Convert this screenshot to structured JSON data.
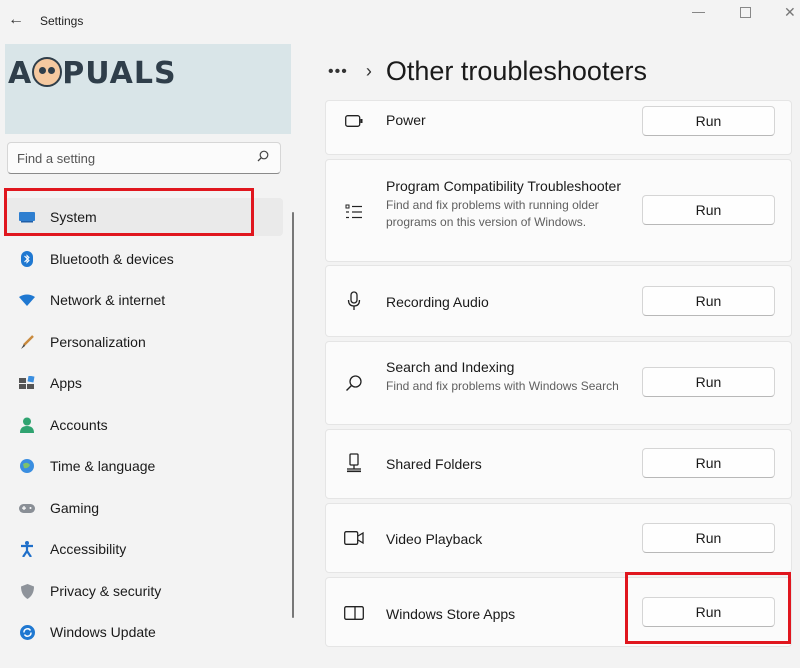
{
  "window": {
    "title": "Settings",
    "back_glyph": "←",
    "minimize_glyph": "—",
    "close_glyph": "✕"
  },
  "logo": {
    "left": "A",
    "right": "PUALS"
  },
  "search": {
    "placeholder": "Find a setting"
  },
  "sidebar": {
    "items": [
      {
        "label": "System",
        "icon": "system-icon"
      },
      {
        "label": "Bluetooth & devices",
        "icon": "bluetooth-icon"
      },
      {
        "label": "Network & internet",
        "icon": "wifi-icon"
      },
      {
        "label": "Personalization",
        "icon": "brush-icon"
      },
      {
        "label": "Apps",
        "icon": "apps-icon"
      },
      {
        "label": "Accounts",
        "icon": "person-icon"
      },
      {
        "label": "Time & language",
        "icon": "globe-clock-icon"
      },
      {
        "label": "Gaming",
        "icon": "gamepad-icon"
      },
      {
        "label": "Accessibility",
        "icon": "accessibility-icon"
      },
      {
        "label": "Privacy & security",
        "icon": "shield-icon"
      },
      {
        "label": "Windows Update",
        "icon": "update-icon"
      }
    ]
  },
  "breadcrumb": {
    "dots": "•••",
    "chevron": "›",
    "title": "Other troubleshooters"
  },
  "troubleshooters": [
    {
      "title": "Power",
      "description": "",
      "icon": "battery-icon",
      "button": "Run"
    },
    {
      "title": "Program Compatibility Troubleshooter",
      "description": "Find and fix problems with running older programs on this version of Windows.",
      "icon": "list-icon",
      "button": "Run"
    },
    {
      "title": "Recording Audio",
      "description": "",
      "icon": "microphone-icon",
      "button": "Run"
    },
    {
      "title": "Search and Indexing",
      "description": "Find and fix problems with Windows Search",
      "icon": "search-icon",
      "button": "Run"
    },
    {
      "title": "Shared Folders",
      "description": "",
      "icon": "shared-folder-icon",
      "button": "Run"
    },
    {
      "title": "Video Playback",
      "description": "",
      "icon": "video-icon",
      "button": "Run"
    },
    {
      "title": "Windows Store Apps",
      "description": "",
      "icon": "store-apps-icon",
      "button": "Run"
    }
  ],
  "colors": {
    "highlight_box": "#e0161e",
    "selected_nav_bg": "#eaeaea",
    "accent": "#0067c0"
  }
}
